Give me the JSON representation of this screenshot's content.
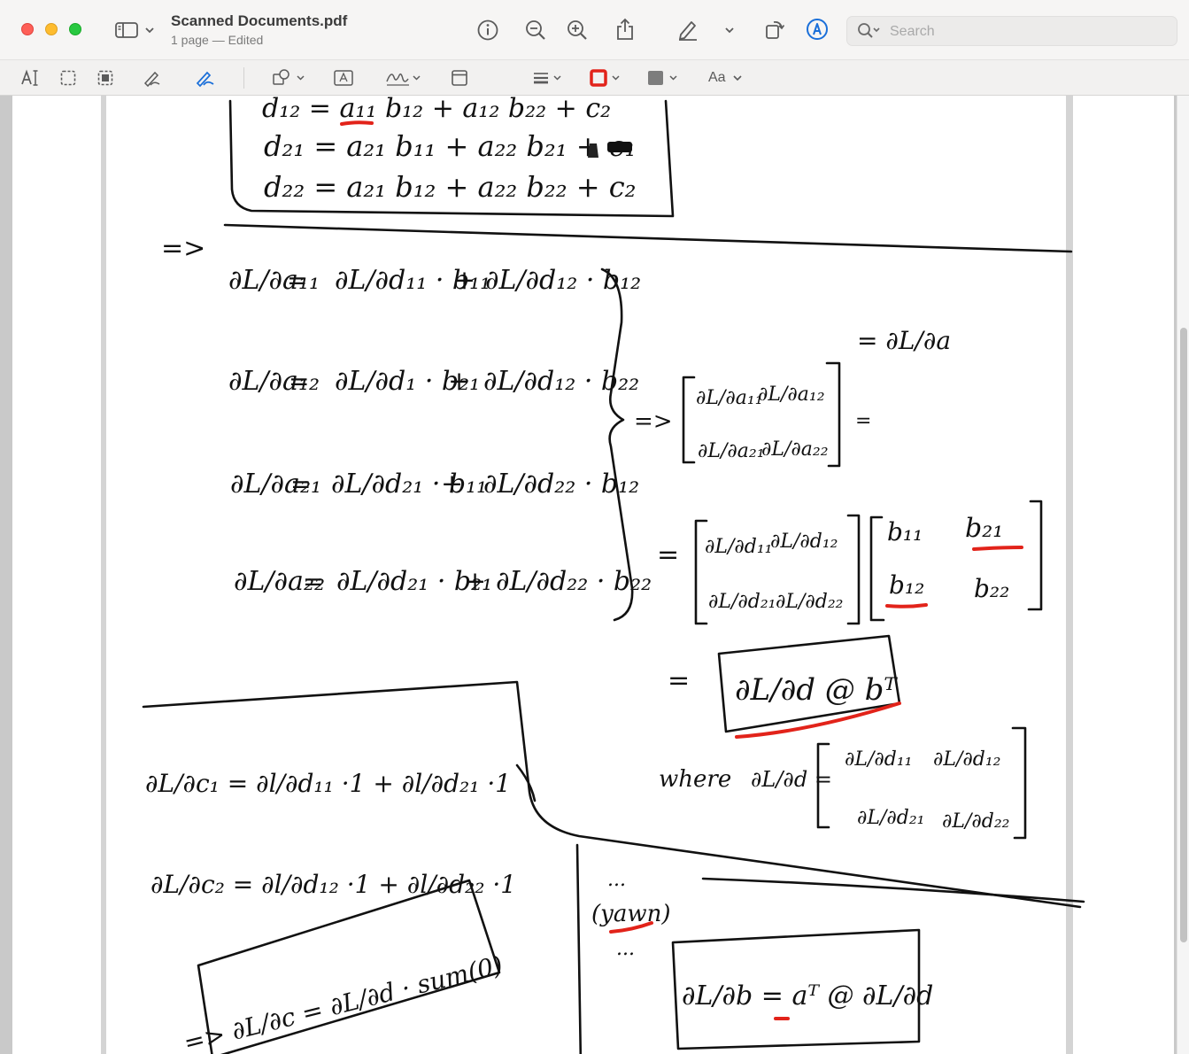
{
  "window": {
    "title": "Scanned Documents.pdf",
    "subtitle": "1 page — Edited"
  },
  "toolbar": {
    "icons": [
      "sidebar-icon",
      "chevron-down-icon",
      "info-icon",
      "zoom-out-icon",
      "zoom-in-icon",
      "share-icon",
      "highlighter-icon",
      "chevron-down-icon",
      "rotate-icon",
      "markup-icon",
      "search-icon"
    ],
    "search_placeholder": "Search"
  },
  "markup_toolbar": {
    "icons": [
      "text-selection-icon",
      "rectangular-selection-icon",
      "smart-lasso-icon",
      "sketch-icon",
      "draw-icon",
      "shapes-icon",
      "text-box-icon",
      "sign-icon",
      "note-icon",
      "line-style-icon",
      "border-color-icon",
      "fill-color-icon"
    ],
    "text_style_label": "Aa",
    "border_color": "#e2231a",
    "fill_color": "#7d7d7d",
    "active_tool_color": "#1a6fd9"
  },
  "notes": {
    "box1": {
      "d12": "d₁₂ = a₁₁ b₁₂ + a₁₂ b₂₂ + c₂",
      "d21": "d₂₁ = a₂₁ b₁₁ + a₂₂ b₂₁ + c₁",
      "d22": "d₂₂ = a₂₁ b₁₂ + a₂₂ b₂₂ + c₂"
    },
    "implies": "=>",
    "grad_a": {
      "row1": {
        "lhs": "∂L/∂a₁₁",
        "t1": "∂L/∂d₁₁ · b₁₁",
        "t2": "∂L/∂d₁₂ · b₁₂"
      },
      "row2": {
        "lhs": "∂L/∂a₁₂",
        "t1": "∂L/∂d₁ · b₂₁",
        "t2": "∂L/∂d₁₂ · b₂₂"
      },
      "row3": {
        "lhs": "∂L/∂a₂₁",
        "t1": "∂L/∂d₂₁ · b₁₁",
        "t2": "∂L/∂d₂₂ · b₁₂"
      },
      "row4": {
        "lhs": "∂L/∂a₂₂",
        "t1": "∂L/∂d₂₁ · b₂₁",
        "t2": "∂L/∂d₂₂ · b₂₂"
      }
    },
    "dLda_label": "= ∂L/∂a",
    "matrix_a": [
      "∂L/∂a₁₁",
      "∂L/∂a₁₂",
      "∂L/∂a₂₁",
      "∂L/∂a₂₂"
    ],
    "matrix_d": [
      "∂L/∂d₁₁",
      "∂L/∂d₁₂",
      "∂L/∂d₂₁",
      "∂L/∂d₂₂"
    ],
    "matrix_b": [
      "b₁₁",
      "b₂₁",
      "b₁₂",
      "b₂₂"
    ],
    "result_a": "∂L/∂d @ bᵀ",
    "where": "where",
    "dLdd_lhs": "∂L/∂d =",
    "grad_c": {
      "c1": "∂L/∂c₁ = ∂l/∂d₁₁ ·1 + ∂l/∂d₂₁ ·1",
      "c2": "∂L/∂c₂ = ∂l/∂d₁₂ ·1 + ∂l/∂d₂₂ ·1",
      "result": "=> ∂L/∂c = ∂L/∂d · sum(0)"
    },
    "grad_b": {
      "dots_top": "...",
      "yawn": "(yawn)",
      "dots_bottom": "...",
      "result": "∂L/∂b = aᵀ @ ∂L/∂d"
    }
  }
}
